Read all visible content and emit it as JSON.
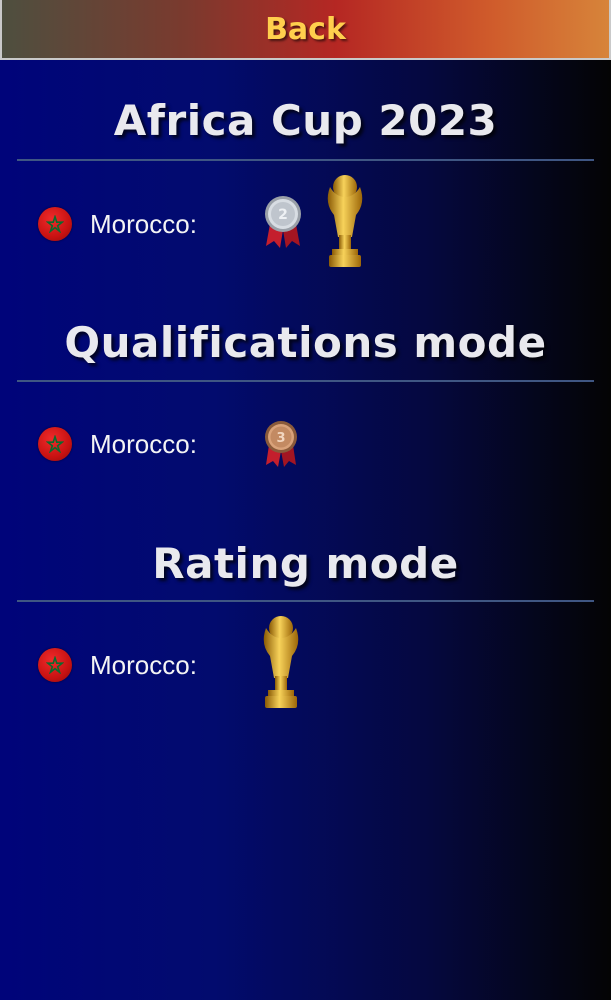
{
  "header": {
    "back_label": "Back"
  },
  "sections": [
    {
      "title": "Africa Cup 2023",
      "entries": [
        {
          "country": "Morocco:",
          "flag_icon": "morocco-flag-icon",
          "awards": [
            "silver-medal-icon",
            "gold-trophy-icon"
          ],
          "medal_text": "2"
        }
      ]
    },
    {
      "title": "Qualifications mode",
      "entries": [
        {
          "country": "Morocco:",
          "flag_icon": "morocco-flag-icon",
          "awards": [
            "bronze-medal-icon"
          ],
          "medal_text": "3"
        }
      ]
    },
    {
      "title": "Rating mode",
      "entries": [
        {
          "country": "Morocco:",
          "flag_icon": "morocco-flag-icon",
          "awards": [
            "gold-trophy-icon"
          ]
        }
      ]
    }
  ],
  "colors": {
    "title": "#e9e9ee",
    "back_text": "#ffcf4d",
    "divider": "#3f5683",
    "flag_red": "#c81212",
    "flag_green": "#0b6b2e"
  }
}
